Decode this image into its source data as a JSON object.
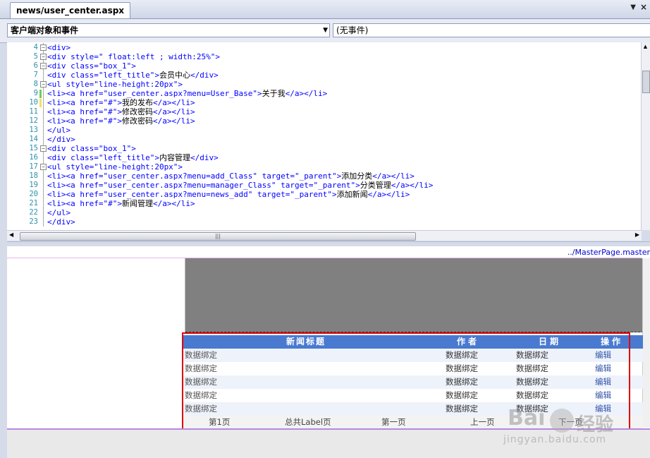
{
  "tab": {
    "title": "news/user_center.aspx"
  },
  "dropdowns": {
    "objects": "客户端对象和事件",
    "events": "(无事件)"
  },
  "code_lines": [
    {
      "n": "4",
      "fold": "-",
      "mark": "",
      "tag": "<div>",
      "text": "",
      "close": ""
    },
    {
      "n": "5",
      "fold": "-",
      "mark": "",
      "tag": "<div style=\" float:left ; width:25%\">",
      "text": "",
      "close": ""
    },
    {
      "n": "6",
      "fold": "-",
      "mark": "",
      "tag": "<div class=\"box_1\">",
      "text": "",
      "close": ""
    },
    {
      "n": "7",
      "fold": "",
      "mark": "",
      "tag": "<div class=\"left_title\">",
      "text": "会员中心",
      "close": "</div>"
    },
    {
      "n": "8",
      "fold": "-",
      "mark": "",
      "tag": "<ul style=\"line-height:20px\">",
      "text": "",
      "close": ""
    },
    {
      "n": "9",
      "fold": "",
      "mark": "green",
      "tag": "<li><a href=\"user_center.aspx?menu=User_Base\">",
      "text": "关于我",
      "close": "</a></li>"
    },
    {
      "n": "10",
      "fold": "",
      "mark": "yellow",
      "tag": "<li><a href=\"#\">",
      "text": "我的发布",
      "close": "</a></li>"
    },
    {
      "n": "11",
      "fold": "",
      "mark": "",
      "tag": "<li><a href=\"#\">",
      "text": "修改密码",
      "close": "</a></li>"
    },
    {
      "n": "12",
      "fold": "",
      "mark": "",
      "tag": "<li><a href=\"#\">",
      "text": "修改密码",
      "close": "</a></li>"
    },
    {
      "n": "13",
      "fold": "",
      "mark": "",
      "tag": "</ul>",
      "text": "",
      "close": ""
    },
    {
      "n": "14",
      "fold": "",
      "mark": "",
      "tag": "</div>",
      "text": "",
      "close": ""
    },
    {
      "n": "15",
      "fold": "-",
      "mark": "",
      "tag": "<div class=\"box_1\">",
      "text": "",
      "close": ""
    },
    {
      "n": "16",
      "fold": "",
      "mark": "",
      "tag": "<div class=\"left_title\">",
      "text": "内容管理",
      "close": "</div>"
    },
    {
      "n": "17",
      "fold": "-",
      "mark": "",
      "tag": "<ul style=\"line-height:20px\">",
      "text": "",
      "close": ""
    },
    {
      "n": "18",
      "fold": "",
      "mark": "",
      "tag": "<li><a href=\"user_center.aspx?menu=add_Class\" target=\"_parent\">",
      "text": "添加分类",
      "close": "</a></li>"
    },
    {
      "n": "19",
      "fold": "",
      "mark": "",
      "tag": "<li><a href=\"user_center.aspx?menu=manager_Class\" target=\"_parent\">",
      "text": "分类管理",
      "close": "</a></li>"
    },
    {
      "n": "20",
      "fold": "",
      "mark": "",
      "tag": "<li><a href=\"user_center.aspx?menu=news_add\" target=\"_parent\">",
      "text": "添加新闻",
      "close": "</a></li>"
    },
    {
      "n": "21",
      "fold": "",
      "mark": "",
      "tag": "<li><a href=\"#\">",
      "text": "新闻管理",
      "close": "</a></li>"
    },
    {
      "n": "22",
      "fold": "",
      "mark": "",
      "tag": "</ul>",
      "text": "",
      "close": ""
    },
    {
      "n": "23",
      "fold": "",
      "mark": "",
      "tag": "</div>",
      "text": "",
      "close": ""
    }
  ],
  "design": {
    "master_link": "../MasterPage.master",
    "grid": {
      "headers": [
        "新闻标题",
        "作者",
        "日期",
        "操作"
      ],
      "rows": [
        [
          "数据绑定",
          "数据绑定",
          "数据绑定",
          "编辑"
        ],
        [
          "数据绑定",
          "数据绑定",
          "数据绑定",
          "编辑"
        ],
        [
          "数据绑定",
          "数据绑定",
          "数据绑定",
          "编辑"
        ],
        [
          "数据绑定",
          "数据绑定",
          "数据绑定",
          "编辑"
        ],
        [
          "数据绑定",
          "数据绑定",
          "数据绑定",
          "编辑"
        ]
      ],
      "pager": [
        "第1页",
        "总共Label页",
        "第一页",
        "上一页",
        "下一页"
      ]
    }
  },
  "watermark": {
    "brand": "Bai",
    "cn": "经验",
    "url": "jingyan.baidu.com"
  },
  "icons": {
    "tab_menu": "triangle-down-icon",
    "tab_close": "close-icon",
    "fold": "fold-minus-icon"
  },
  "colors": {
    "grid_header": "#4a7ad0",
    "highlight_box": "#e00000",
    "line_number": "#2b91af"
  }
}
